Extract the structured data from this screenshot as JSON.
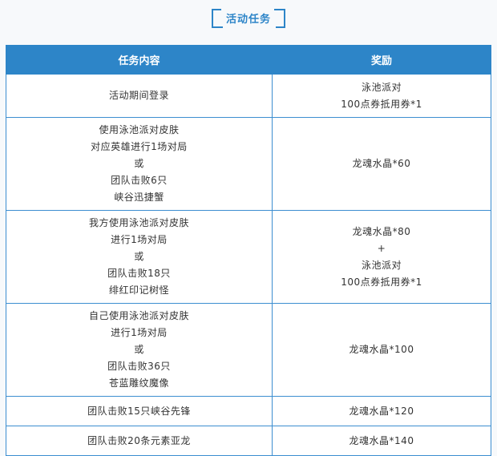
{
  "section_title": "活动任务",
  "table": {
    "headers": [
      "任务内容",
      "奖励"
    ],
    "rows": [
      {
        "task": [
          "活动期间登录"
        ],
        "reward": [
          "泳池派对",
          "100点券抵用券*1"
        ]
      },
      {
        "task": [
          "使用泳池派对皮肤",
          "对应英雄进行1场对局",
          "或",
          "团队击败6只",
          "峡谷迅捷蟹"
        ],
        "reward": [
          "龙魂水晶*60"
        ]
      },
      {
        "task": [
          "我方使用泳池派对皮肤",
          "进行1场对局",
          "或",
          "团队击败18只",
          "绯红印记树怪"
        ],
        "reward": [
          "龙魂水晶*80",
          "+",
          "泳池派对",
          "100点券抵用券*1"
        ]
      },
      {
        "task": [
          "自己使用泳池派对皮肤",
          "进行1场对局",
          "或",
          "团队击败36只",
          "苍蓝雕纹魔像"
        ],
        "reward": [
          "龙魂水晶*100"
        ]
      },
      {
        "task": [
          "团队击败15只峡谷先锋"
        ],
        "reward": [
          "龙魂水晶*120"
        ]
      },
      {
        "task": [
          "团队击败20条元素亚龙"
        ],
        "reward": [
          "龙魂水晶*140"
        ]
      }
    ]
  },
  "colors": {
    "accent": "#2d85c8",
    "border": "#3c8ed0"
  }
}
